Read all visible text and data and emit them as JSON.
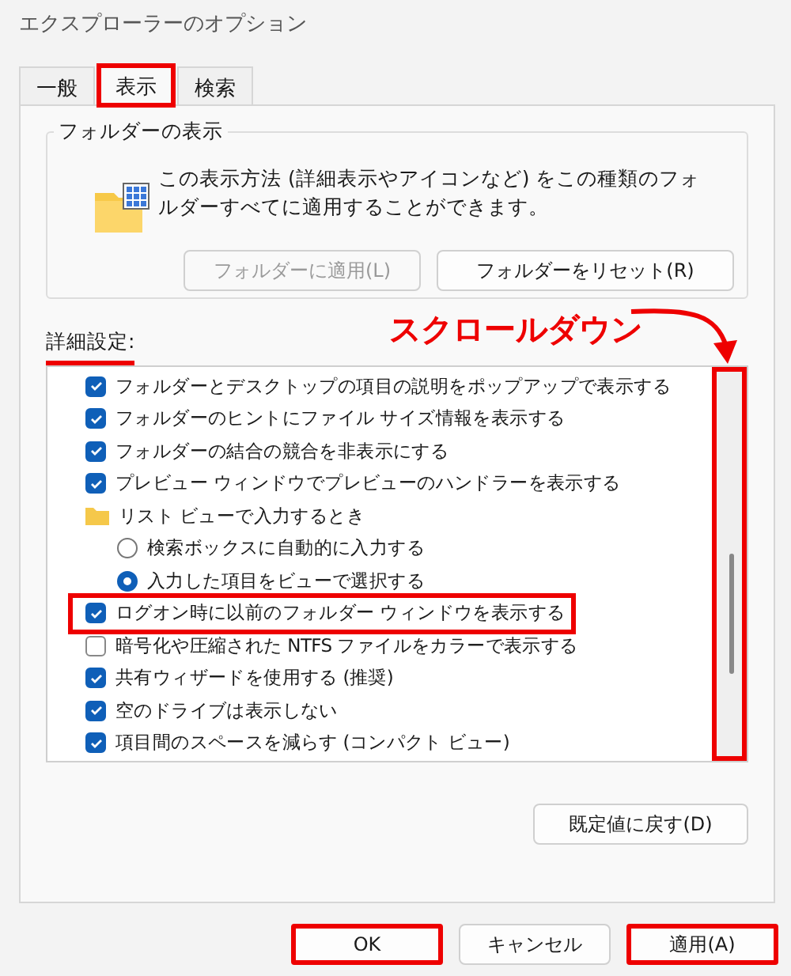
{
  "window": {
    "title": "エクスプローラーのオプション"
  },
  "tabs": [
    {
      "label": "一般",
      "selected": false,
      "highlighted": false
    },
    {
      "label": "表示",
      "selected": true,
      "highlighted": true
    },
    {
      "label": "検索",
      "selected": false,
      "highlighted": false
    }
  ],
  "folder_view": {
    "title": "フォルダーの表示",
    "description": "この表示方法 (詳細表示やアイコンなど) をこの種類のフォルダーすべてに適用することができます。",
    "buttons": [
      {
        "label": "フォルダーに適用(L)",
        "disabled": true
      },
      {
        "label": "フォルダーをリセット(R)",
        "disabled": false
      }
    ]
  },
  "advanced": {
    "label": "詳細設定:",
    "underlined": true,
    "annotation": "スクロールダウン",
    "scrollbar_highlighted": true,
    "options": [
      {
        "kind": "checkbox",
        "label": "フォルダーとデスクトップの項目の説明をポップアップで表示する",
        "checked": true,
        "highlighted": false
      },
      {
        "kind": "checkbox",
        "label": "フォルダーのヒントにファイル サイズ情報を表示する",
        "checked": true,
        "highlighted": false
      },
      {
        "kind": "checkbox",
        "label": "フォルダーの結合の競合を非表示にする",
        "checked": true,
        "highlighted": false
      },
      {
        "kind": "checkbox",
        "label": "プレビュー ウィンドウでプレビューのハンドラーを表示する",
        "checked": true,
        "highlighted": false
      },
      {
        "kind": "folder",
        "label": "リスト ビューで入力するとき",
        "children": [
          {
            "kind": "radio",
            "label": "検索ボックスに自動的に入力する",
            "selected": false
          },
          {
            "kind": "radio",
            "label": "入力した項目をビューで選択する",
            "selected": true
          }
        ]
      },
      {
        "kind": "checkbox",
        "label": "ログオン時に以前のフォルダー ウィンドウを表示する",
        "checked": true,
        "highlighted": true
      },
      {
        "kind": "checkbox",
        "label": "暗号化や圧縮された NTFS ファイルをカラーで表示する",
        "checked": false,
        "highlighted": false
      },
      {
        "kind": "checkbox",
        "label": "共有ウィザードを使用する (推奨)",
        "checked": true,
        "highlighted": false
      },
      {
        "kind": "checkbox",
        "label": "空のドライブは表示しない",
        "checked": true,
        "highlighted": false
      },
      {
        "kind": "checkbox",
        "label": "項目間のスペースを減らす (コンパクト ビュー)",
        "checked": true,
        "highlighted": false
      }
    ],
    "restore_button": "既定値に戻す(D)"
  },
  "buttons": [
    {
      "label": "OK",
      "highlighted": true
    },
    {
      "label": "キャンセル",
      "highlighted": false
    },
    {
      "label": "適用(A)",
      "highlighted": true
    }
  ]
}
